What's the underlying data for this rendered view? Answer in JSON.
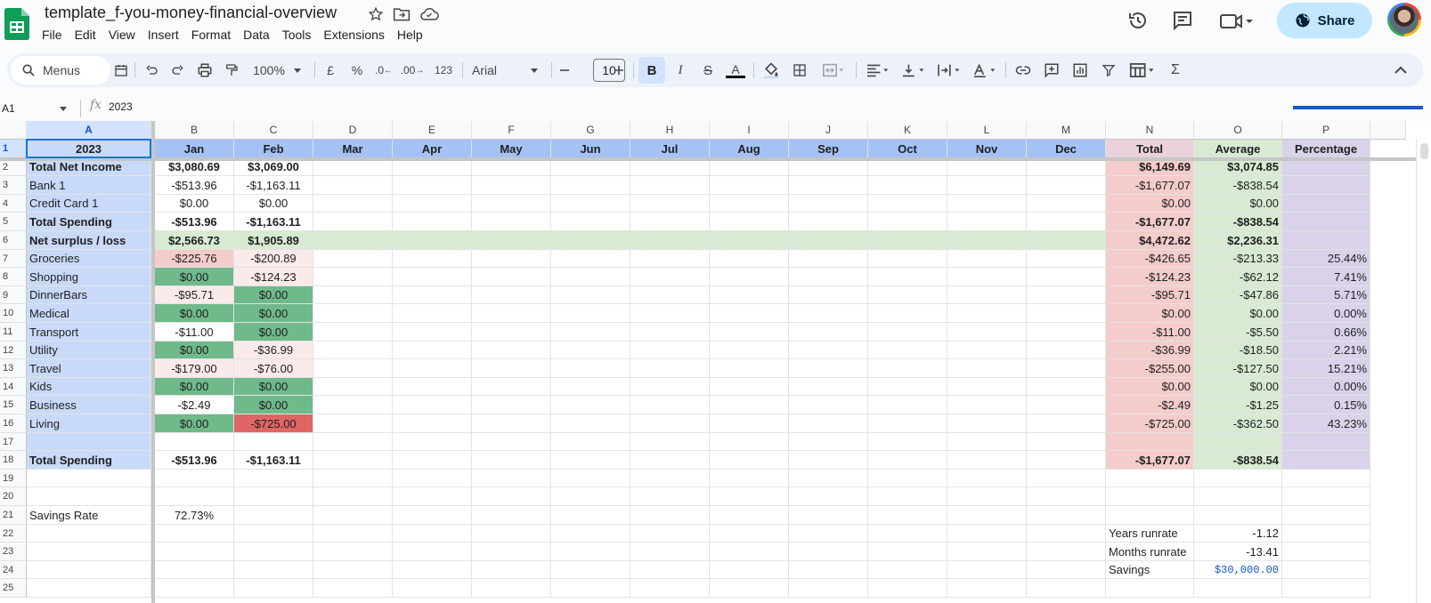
{
  "app": {
    "title": "template_f-you-money-financial-overview",
    "menu": [
      "File",
      "Edit",
      "View",
      "Insert",
      "Format",
      "Data",
      "Tools",
      "Extensions",
      "Help"
    ],
    "share_label": "Share"
  },
  "toolbar": {
    "menus_label": "Menus",
    "zoom": "100%",
    "currency": "£",
    "percent": "%",
    "dec_decrease": ".0",
    "dec_increase": ".00",
    "number_format": "123",
    "font": "Arial",
    "font_size": "10"
  },
  "formula_bar": {
    "cell_ref": "A1",
    "fx": "fx",
    "value": "2023"
  },
  "columns": [
    "A",
    "B",
    "C",
    "D",
    "E",
    "F",
    "G",
    "H",
    "I",
    "J",
    "K",
    "L",
    "M",
    "N",
    "O",
    "P"
  ],
  "rows": [
    {
      "n": "1",
      "cells": [
        "2023",
        "Jan",
        "Feb",
        "Mar",
        "Apr",
        "May",
        "Jun",
        "Jul",
        "Aug",
        "Sep",
        "Oct",
        "Nov",
        "Dec",
        "Total",
        "Average",
        "Percentage"
      ]
    },
    {
      "n": "2",
      "cells": [
        "Total Net Income",
        "$3,080.69",
        "$3,069.00",
        "",
        "",
        "",
        "",
        "",
        "",
        "",
        "",
        "",
        "",
        "$6,149.69",
        "$3,074.85",
        ""
      ]
    },
    {
      "n": "3",
      "cells": [
        "Bank 1",
        "-$513.96",
        "-$1,163.11",
        "",
        "",
        "",
        "",
        "",
        "",
        "",
        "",
        "",
        "",
        "-$1,677.07",
        "-$838.54",
        ""
      ]
    },
    {
      "n": "4",
      "cells": [
        "Credit Card 1",
        "$0.00",
        "$0.00",
        "",
        "",
        "",
        "",
        "",
        "",
        "",
        "",
        "",
        "",
        "$0.00",
        "$0.00",
        ""
      ]
    },
    {
      "n": "5",
      "cells": [
        "Total Spending",
        "-$513.96",
        "-$1,163.11",
        "",
        "",
        "",
        "",
        "",
        "",
        "",
        "",
        "",
        "",
        "-$1,677.07",
        "-$838.54",
        ""
      ]
    },
    {
      "n": "6",
      "cells": [
        "Net surplus / loss",
        "$2,566.73",
        "$1,905.89",
        "",
        "",
        "",
        "",
        "",
        "",
        "",
        "",
        "",
        "",
        "$4,472.62",
        "$2,236.31",
        ""
      ]
    },
    {
      "n": "7",
      "cells": [
        "Groceries",
        "-$225.76",
        "-$200.89",
        "",
        "",
        "",
        "",
        "",
        "",
        "",
        "",
        "",
        "",
        "-$426.65",
        "-$213.33",
        "25.44%"
      ]
    },
    {
      "n": "8",
      "cells": [
        "Shopping",
        "$0.00",
        "-$124.23",
        "",
        "",
        "",
        "",
        "",
        "",
        "",
        "",
        "",
        "",
        "-$124.23",
        "-$62.12",
        "7.41%"
      ]
    },
    {
      "n": "9",
      "cells": [
        "DinnerBars",
        "-$95.71",
        "$0.00",
        "",
        "",
        "",
        "",
        "",
        "",
        "",
        "",
        "",
        "",
        "-$95.71",
        "-$47.86",
        "5.71%"
      ]
    },
    {
      "n": "10",
      "cells": [
        "Medical",
        "$0.00",
        "$0.00",
        "",
        "",
        "",
        "",
        "",
        "",
        "",
        "",
        "",
        "",
        "$0.00",
        "$0.00",
        "0.00%"
      ]
    },
    {
      "n": "11",
      "cells": [
        "Transport",
        "-$11.00",
        "$0.00",
        "",
        "",
        "",
        "",
        "",
        "",
        "",
        "",
        "",
        "",
        "-$11.00",
        "-$5.50",
        "0.66%"
      ]
    },
    {
      "n": "12",
      "cells": [
        "Utility",
        "$0.00",
        "-$36.99",
        "",
        "",
        "",
        "",
        "",
        "",
        "",
        "",
        "",
        "",
        "-$36.99",
        "-$18.50",
        "2.21%"
      ]
    },
    {
      "n": "13",
      "cells": [
        "Travel",
        "-$179.00",
        "-$76.00",
        "",
        "",
        "",
        "",
        "",
        "",
        "",
        "",
        "",
        "",
        "-$255.00",
        "-$127.50",
        "15.21%"
      ]
    },
    {
      "n": "14",
      "cells": [
        "Kids",
        "$0.00",
        "$0.00",
        "",
        "",
        "",
        "",
        "",
        "",
        "",
        "",
        "",
        "",
        "$0.00",
        "$0.00",
        "0.00%"
      ]
    },
    {
      "n": "15",
      "cells": [
        "Business",
        "-$2.49",
        "$0.00",
        "",
        "",
        "",
        "",
        "",
        "",
        "",
        "",
        "",
        "",
        "-$2.49",
        "-$1.25",
        "0.15%"
      ]
    },
    {
      "n": "16",
      "cells": [
        "Living",
        "$0.00",
        "-$725.00",
        "",
        "",
        "",
        "",
        "",
        "",
        "",
        "",
        "",
        "",
        "-$725.00",
        "-$362.50",
        "43.23%"
      ]
    },
    {
      "n": "17",
      "cells": [
        "",
        "",
        "",
        "",
        "",
        "",
        "",
        "",
        "",
        "",
        "",
        "",
        "",
        "",
        "",
        ""
      ]
    },
    {
      "n": "18",
      "cells": [
        "Total Spending",
        "-$513.96",
        "-$1,163.11",
        "",
        "",
        "",
        "",
        "",
        "",
        "",
        "",
        "",
        "",
        "-$1,677.07",
        "-$838.54",
        ""
      ]
    },
    {
      "n": "19",
      "cells": [
        "",
        "",
        "",
        "",
        "",
        "",
        "",
        "",
        "",
        "",
        "",
        "",
        "",
        "",
        "",
        ""
      ]
    },
    {
      "n": "20",
      "cells": [
        "",
        "",
        "",
        "",
        "",
        "",
        "",
        "",
        "",
        "",
        "",
        "",
        "",
        "",
        "",
        ""
      ]
    },
    {
      "n": "21",
      "cells": [
        "Savings Rate",
        "72.73%",
        "",
        "",
        "",
        "",
        "",
        "",
        "",
        "",
        "",
        "",
        "",
        "",
        "",
        ""
      ]
    },
    {
      "n": "22",
      "cells": [
        "",
        "",
        "",
        "",
        "",
        "",
        "",
        "",
        "",
        "",
        "",
        "",
        "",
        "Years runrate",
        "-1.12",
        ""
      ]
    },
    {
      "n": "23",
      "cells": [
        "",
        "",
        "",
        "",
        "",
        "",
        "",
        "",
        "",
        "",
        "",
        "",
        "",
        "Months runrate",
        "-13.41",
        ""
      ]
    },
    {
      "n": "24",
      "cells": [
        "",
        "",
        "",
        "",
        "",
        "",
        "",
        "",
        "",
        "",
        "",
        "",
        "",
        "Savings",
        "$30,000.00",
        ""
      ]
    },
    {
      "n": "25",
      "cells": [
        "",
        "",
        "",
        "",
        "",
        "",
        "",
        "",
        "",
        "",
        "",
        "",
        "",
        "",
        "",
        ""
      ]
    }
  ],
  "colors": {
    "header_blue": "#a4c2f4",
    "col_a_blue": "#c9daf8",
    "total_pink": "#ead1dc",
    "total_cells": "#f4cccc",
    "average_green": "#d9ead3",
    "percentage_purple": "#d9d2e9",
    "surplus_row": "#d9ead3",
    "good_green": "#6fb98a",
    "light_red": "#f4cccc",
    "lighter_red": "#fbeaea",
    "strong_red": "#e06666",
    "savings_blue": "#1155cc"
  }
}
